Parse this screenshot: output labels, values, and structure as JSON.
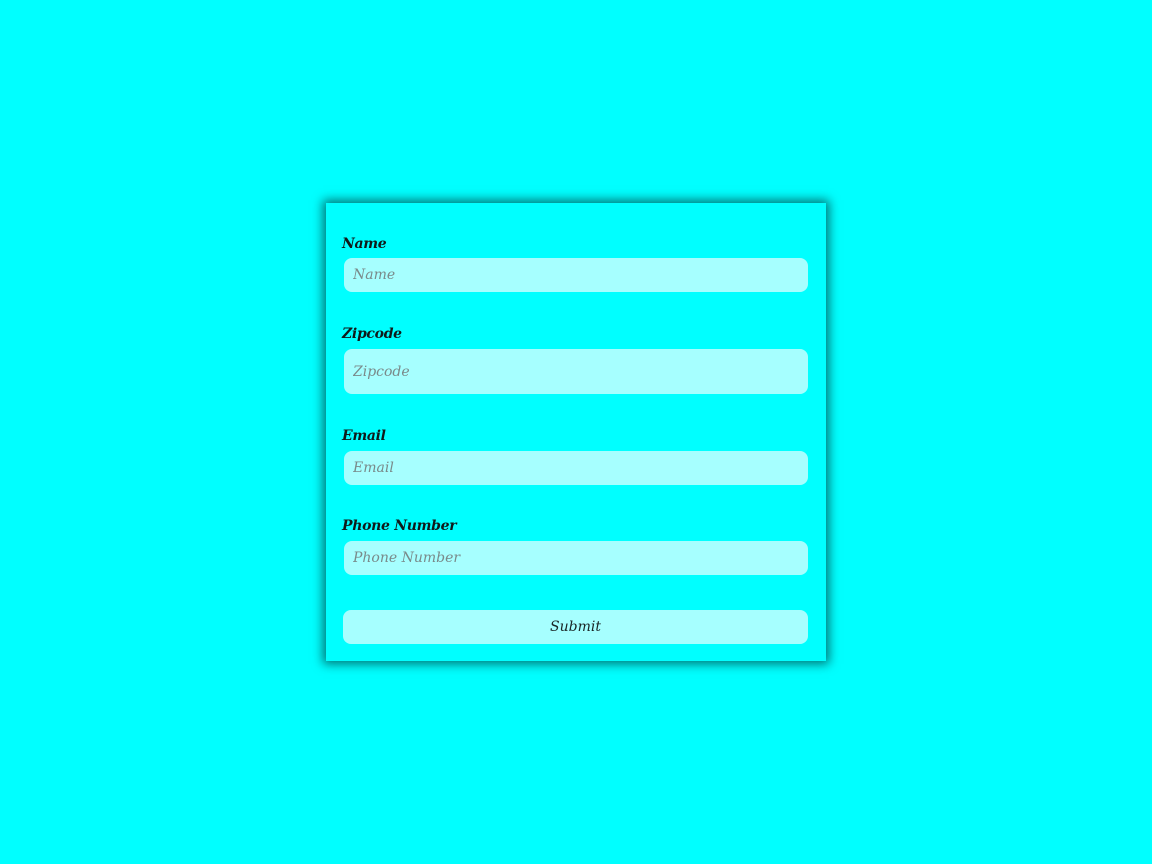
{
  "form": {
    "fields": [
      {
        "label": "Name",
        "placeholder": "Name",
        "value": ""
      },
      {
        "label": "Zipcode",
        "placeholder": "Zipcode",
        "value": ""
      },
      {
        "label": "Email",
        "placeholder": "Email",
        "value": ""
      },
      {
        "label": "Phone Number",
        "placeholder": "Phone Number",
        "value": ""
      }
    ],
    "submit_label": "Submit"
  },
  "colors": {
    "background": "#00ffff",
    "input_background": "#a6ffff",
    "label_text": "#101a1a",
    "placeholder_text": "#7a8a8a"
  }
}
